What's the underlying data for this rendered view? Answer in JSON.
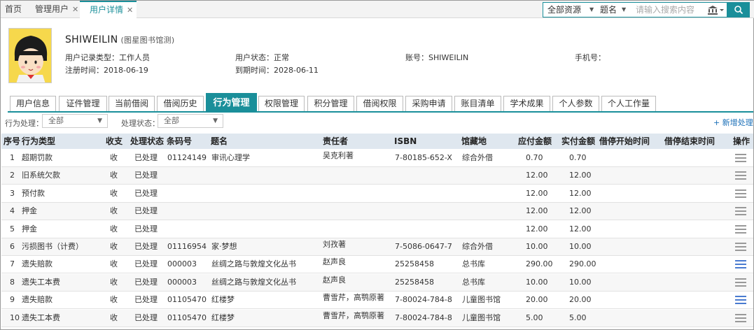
{
  "top_tabs": [
    {
      "label": "首页"
    },
    {
      "label": "管理用户"
    },
    {
      "label": "用户详情"
    }
  ],
  "search": {
    "scope": "全部资源",
    "field": "题名",
    "placeholder": "请输入搜索内容"
  },
  "profile": {
    "name": "SHIWEILIN",
    "org": "(图星图书馆测)",
    "record_type_label": "用户记录类型：",
    "record_type": "工作人员",
    "status_label": "用户状态：",
    "status": "正常",
    "account_label": "账号：",
    "account": "SHIWEILIN",
    "phone_label": "手机号：",
    "phone": "",
    "reg_label": "注册时间：",
    "reg_date": "2018-06-19",
    "expire_label": "到期时间：",
    "expire_date": "2028-06-11"
  },
  "sub_tabs": [
    "用户信息",
    "证件管理",
    "当前借阅",
    "借阅历史",
    "行为管理",
    "权限管理",
    "积分管理",
    "借阅权限",
    "采购申请",
    "账目清单",
    "学术成果",
    "个人参数",
    "个人工作量"
  ],
  "active_sub_tab": 4,
  "filters": {
    "process_label": "行为处理：",
    "process_value": "全部",
    "status_label": "处理状态：",
    "status_value": "全部",
    "add_label": "+ 新增处理"
  },
  "table": {
    "headers": [
      "序号",
      "行为类型",
      "收支",
      "处理状态",
      "条码号",
      "题名",
      "责任者",
      "ISBN",
      "馆藏地",
      "应付金额",
      "实付金额",
      "借停开始时间",
      "借停结束时间",
      "操作"
    ],
    "rows": [
      {
        "no": "1",
        "type": "超期罚款",
        "io": "收",
        "state": "已处理",
        "barcode": "01124149",
        "title": "审讯心理学",
        "author": "吴克利著",
        "isbn": "7-80185-652-X",
        "loc": "综合外借",
        "due": "0.70",
        "paid": "0.70",
        "menu_color": "gray"
      },
      {
        "no": "2",
        "type": "旧系统欠款",
        "io": "收",
        "state": "已处理",
        "barcode": "",
        "title": "",
        "author": "",
        "isbn": "",
        "loc": "",
        "due": "12.00",
        "paid": "12.00",
        "menu_color": "gray"
      },
      {
        "no": "3",
        "type": "预付款",
        "io": "收",
        "state": "已处理",
        "barcode": "",
        "title": "",
        "author": "",
        "isbn": "",
        "loc": "",
        "due": "12.00",
        "paid": "12.00",
        "menu_color": "gray"
      },
      {
        "no": "4",
        "type": "押金",
        "io": "收",
        "state": "已处理",
        "barcode": "",
        "title": "",
        "author": "",
        "isbn": "",
        "loc": "",
        "due": "12.00",
        "paid": "12.00",
        "menu_color": "gray"
      },
      {
        "no": "5",
        "type": "押金",
        "io": "收",
        "state": "已处理",
        "barcode": "",
        "title": "",
        "author": "",
        "isbn": "",
        "loc": "",
        "due": "12.00",
        "paid": "12.00",
        "menu_color": "gray"
      },
      {
        "no": "6",
        "type": "污损图书（计费）",
        "io": "收",
        "state": "已处理",
        "barcode": "01116954",
        "title": "家·梦想",
        "author": "刘孜著",
        "isbn": "7-5086-0647-7",
        "loc": "综合外借",
        "due": "10.00",
        "paid": "10.00",
        "menu_color": "gray"
      },
      {
        "no": "7",
        "type": "遗失赔款",
        "io": "收",
        "state": "已处理",
        "barcode": "000003",
        "title": "丝绸之路与敦煌文化丛书",
        "author": "赵声良",
        "isbn": "25258458",
        "loc": "总书库",
        "due": "290.00",
        "paid": "290.00",
        "menu_color": "blue"
      },
      {
        "no": "8",
        "type": "遗失工本费",
        "io": "收",
        "state": "已处理",
        "barcode": "000003",
        "title": "丝绸之路与敦煌文化丛书",
        "author": "赵声良",
        "isbn": "25258458",
        "loc": "总书库",
        "due": "10.00",
        "paid": "10.00",
        "menu_color": "gray"
      },
      {
        "no": "9",
        "type": "遗失赔款",
        "io": "收",
        "state": "已处理",
        "barcode": "01105470",
        "title": "红楼梦",
        "author": "曹雪芹，高鹗原著",
        "isbn": "7-80024-784-8",
        "loc": "儿童图书馆",
        "due": "20.00",
        "paid": "20.00",
        "menu_color": "blue"
      },
      {
        "no": "10",
        "type": "遗失工本费",
        "io": "收",
        "state": "已处理",
        "barcode": "01105470",
        "title": "红楼梦",
        "author": "曹雪芹，高鹗原著",
        "isbn": "7-80024-784-8",
        "loc": "儿童图书馆",
        "due": "5.00",
        "paid": "5.00",
        "menu_color": "gray"
      }
    ]
  },
  "colors": {
    "accent": "#1a8f9a",
    "header_bg": "#dfe7ef",
    "link": "#1a6fb8"
  },
  "icons": {
    "search": "search-icon",
    "library": "library-icon",
    "menu": "hamburger-menu-icon",
    "close": "close-icon",
    "dropdown": "chevron-down-icon"
  }
}
